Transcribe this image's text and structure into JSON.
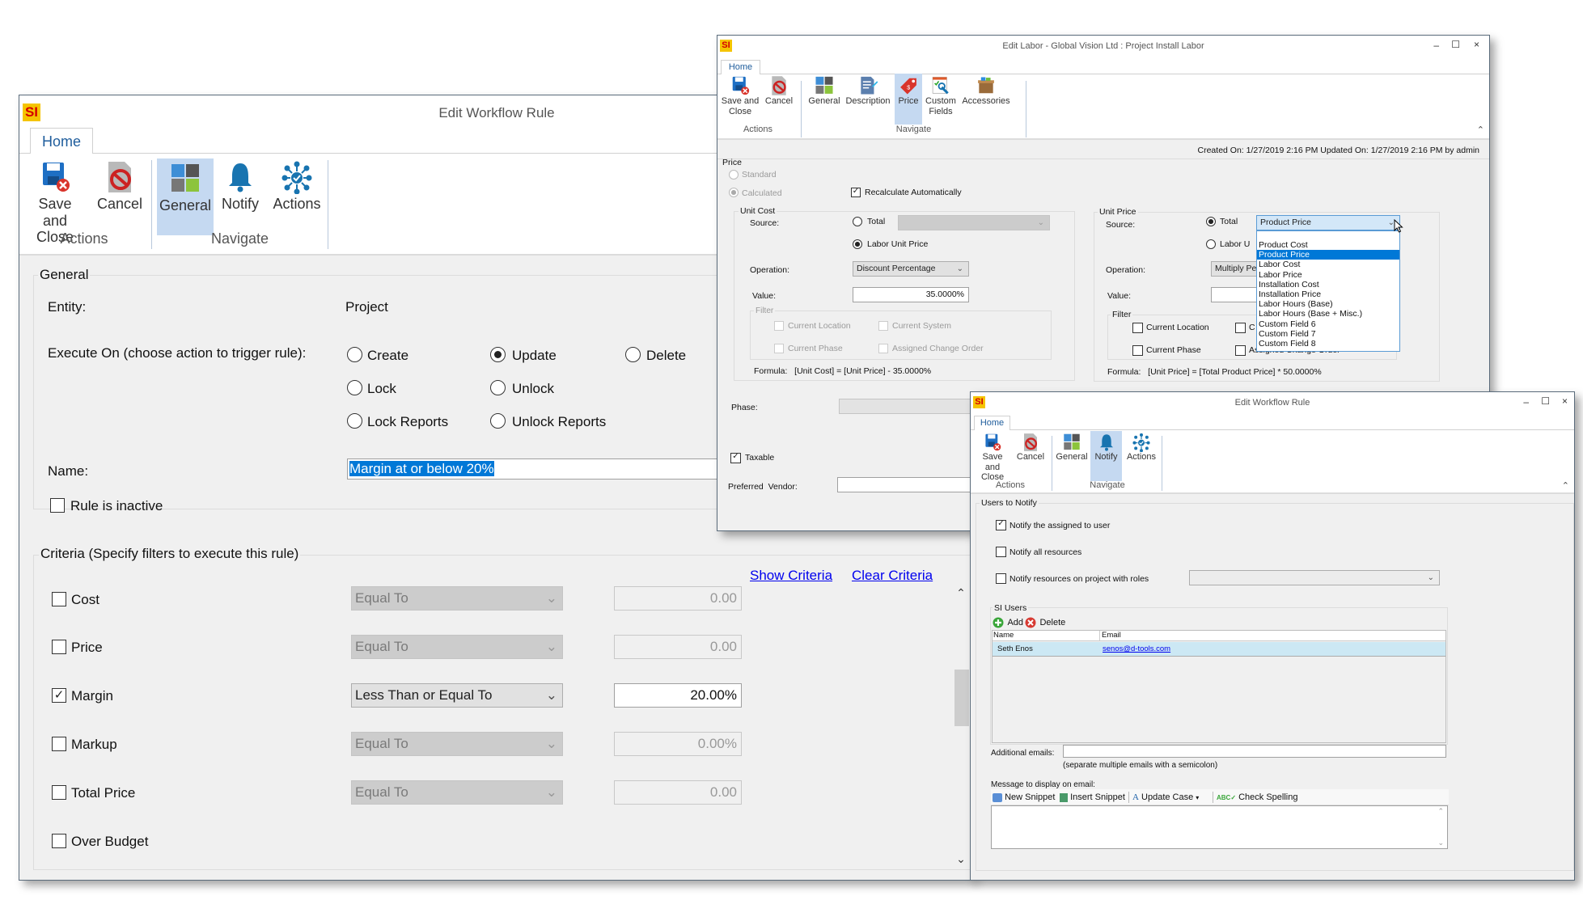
{
  "main_window": {
    "logo": "SI",
    "title": "Edit Workflow Rule",
    "tab": "Home",
    "ribbon": {
      "buttons": [
        {
          "label": "Save and Close",
          "icon": "save-close-icon"
        },
        {
          "label": "Cancel",
          "icon": "cancel-icon"
        },
        {
          "label": "General",
          "icon": "general-icon",
          "selected": true
        },
        {
          "label": "Notify",
          "icon": "bell-icon"
        },
        {
          "label": "Actions",
          "icon": "actions-icon"
        }
      ],
      "groups": [
        "Actions",
        "Navigate"
      ]
    },
    "general": {
      "legend": "General",
      "entity_label": "Entity:",
      "entity_value": "Project",
      "execute_label": "Execute On (choose action to trigger rule):",
      "execute_options": [
        {
          "label": "Create",
          "checked": false
        },
        {
          "label": "Update",
          "checked": true
        },
        {
          "label": "Delete",
          "checked": false
        },
        {
          "label": "Lock",
          "checked": false
        },
        {
          "label": "Unlock",
          "checked": false
        },
        {
          "label": "Lock Reports",
          "checked": false
        },
        {
          "label": "Unlock Reports",
          "checked": false
        }
      ],
      "name_label": "Name:",
      "name_value": "Margin at or below 20%",
      "inactive_label": "Rule is inactive",
      "inactive_checked": false
    },
    "criteria": {
      "legend": "Criteria (Specify filters to execute this rule)",
      "show_link": "Show Criteria",
      "clear_link": "Clear Criteria",
      "rows": [
        {
          "label": "Cost",
          "checked": false,
          "operator": "Equal To",
          "value": "0.00"
        },
        {
          "label": "Price",
          "checked": false,
          "operator": "Equal To",
          "value": "0.00"
        },
        {
          "label": "Margin",
          "checked": true,
          "operator": "Less Than or Equal To",
          "value": "20.00%"
        },
        {
          "label": "Markup",
          "checked": false,
          "operator": "Equal To",
          "value": "0.00%"
        },
        {
          "label": "Total Price",
          "checked": false,
          "operator": "Equal To",
          "value": "0.00"
        },
        {
          "label": "Over Budget",
          "checked": false
        }
      ]
    }
  },
  "labor_window": {
    "logo": "SI",
    "title": "Edit Labor - Global Vision Ltd : Project Install Labor",
    "controls": [
      "–",
      "☐",
      "×"
    ],
    "tab": "Home",
    "ribbon": {
      "buttons": [
        {
          "label": "Save and Close",
          "icon": "save-close-icon"
        },
        {
          "label": "Cancel",
          "icon": "cancel-icon"
        },
        {
          "label": "General",
          "icon": "general-icon"
        },
        {
          "label": "Description",
          "icon": "description-icon"
        },
        {
          "label": "Price",
          "icon": "price-tag-icon",
          "selected": true
        },
        {
          "label": "Custom Fields",
          "icon": "custom-fields-icon"
        },
        {
          "label": "Accessories",
          "icon": "accessories-box-icon"
        }
      ],
      "groups": [
        "Actions",
        "Navigate"
      ]
    },
    "status": "Created On: 1/27/2019 2:16 PM  Updated On: 1/27/2019 2:16 PM by admin",
    "price": {
      "legend": "Price",
      "standard_label": "Standard",
      "calculated_label": "Calculated",
      "recalc_label": "Recalculate Automatically",
      "recalc_checked": true
    },
    "unit_cost": {
      "legend": "Unit Cost",
      "source_label": "Source:",
      "total_label": "Total",
      "labor_unit_label": "Labor Unit Price",
      "operation_label": "Operation:",
      "operation_value": "Discount Percentage",
      "value_label": "Value:",
      "value": "35.0000%",
      "filter_legend": "Filter",
      "filters": [
        "Current Location",
        "Current System",
        "Current Phase",
        "Assigned Change Order"
      ],
      "formula": "Formula:   [Unit Cost] = [Unit Price] - 35.0000%"
    },
    "unit_price": {
      "legend": "Unit Price",
      "source_label": "Source:",
      "total_label": "Total",
      "total_value": "Product Price",
      "labor_unit_label": "Labor U",
      "operation_label": "Operation:",
      "operation_value": "Multiply Per",
      "value_label": "Value:",
      "filter_legend": "Filter",
      "filters": [
        "Current Location",
        "C",
        "Current Phase",
        "Assigned Change Order"
      ],
      "formula": "Formula:   [Unit Price] = [Total Product Price] * 50.0000%",
      "dropdown_options": [
        "",
        "Product Cost",
        "Product Price",
        "Labor Cost",
        "Labor Price",
        "Installation Cost",
        "Installation Price",
        "Labor Hours (Base)",
        "Labor Hours (Base + Misc.)",
        "Custom Field 6",
        "Custom Field 7",
        "Custom Field 8"
      ],
      "dropdown_selected": "Product Price"
    },
    "phase_label": "Phase:",
    "taxable_label": "Taxable",
    "taxable_checked": true,
    "vendor_label": "Preferred  Vendor:"
  },
  "notify_window": {
    "logo": "SI",
    "title": "Edit Workflow Rule",
    "controls": [
      "–",
      "☐",
      "×"
    ],
    "tab": "Home",
    "ribbon": {
      "buttons": [
        {
          "label": "Save and Close",
          "icon": "save-close-icon"
        },
        {
          "label": "Cancel",
          "icon": "cancel-icon"
        },
        {
          "label": "General",
          "icon": "general-icon"
        },
        {
          "label": "Notify",
          "icon": "bell-icon",
          "selected": true
        },
        {
          "label": "Actions",
          "icon": "actions-icon"
        }
      ],
      "groups": [
        "Actions",
        "Navigate"
      ]
    },
    "users_legend": "Users to Notify",
    "notify_assigned": {
      "label": "Notify the assigned to user",
      "checked": true
    },
    "notify_all": {
      "label": "Notify all resources",
      "checked": false
    },
    "notify_roles": {
      "label": "Notify resources on project with roles",
      "checked": false
    },
    "si_users": {
      "legend": "SI Users",
      "add_label": "Add",
      "delete_label": "Delete",
      "columns": [
        "Name",
        "Email"
      ],
      "rows": [
        {
          "name": "Seth Enos",
          "email": "senos@d-tools.com"
        }
      ]
    },
    "additional_label": "Additional emails:",
    "additional_hint": "(separate multiple emails with a semicolon)",
    "message_label": "Message to display on email:",
    "toolbar": [
      "New Snippet",
      "Insert Snippet",
      "Update Case",
      "Check Spelling"
    ]
  },
  "colors": {
    "accent_selected": "#c5d9f1",
    "link": "#0000ee",
    "highlight": "#0078d7",
    "row_selected": "#cce8f4"
  }
}
